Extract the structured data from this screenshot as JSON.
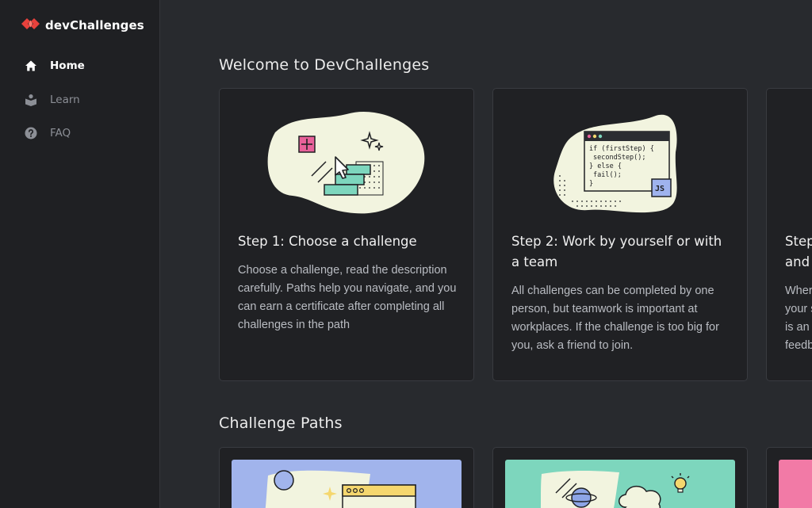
{
  "brand": {
    "name": "devChallenges",
    "logo_color": "#e8413c"
  },
  "nav": {
    "items": [
      {
        "label": "Home",
        "icon": "home-icon",
        "active": true
      },
      {
        "label": "Learn",
        "icon": "learn-icon",
        "active": false
      },
      {
        "label": "FAQ",
        "icon": "help-circle-icon",
        "active": false
      }
    ]
  },
  "welcome": {
    "title": "Welcome to DevChallenges",
    "steps": [
      {
        "title": "Step 1: Choose a challenge",
        "body": "Choose a challenge, read the description carefully. Paths help you navigate, and you can earn a certificate after completing all challenges in the path"
      },
      {
        "title": "Step 2: Work by yourself or with a team",
        "body": "All challenges can be completed by one person, but teamwork is important at workplaces. If the challenge is too big for you, ask a friend to join.",
        "code_lines": [
          "if (firstStep) {",
          "  secondStep();",
          "} else {",
          "  fail();",
          "}"
        ],
        "code_badge": "JS"
      },
      {
        "title_visible": [
          "Step",
          "and"
        ],
        "body_visible": [
          "Wher",
          "your s",
          "is an e",
          "feedb"
        ]
      }
    ]
  },
  "paths": {
    "title": "Challenge Paths",
    "banner_colors": [
      "#a1b4ec",
      "#7dd6bd",
      "#f27aa6"
    ]
  },
  "colors": {
    "background": "#282a2e",
    "sidebar": "#1f2023",
    "card": "#202124",
    "blob": "#f2f4df",
    "teal": "#7dd6bd",
    "pink": "#e8619a"
  }
}
